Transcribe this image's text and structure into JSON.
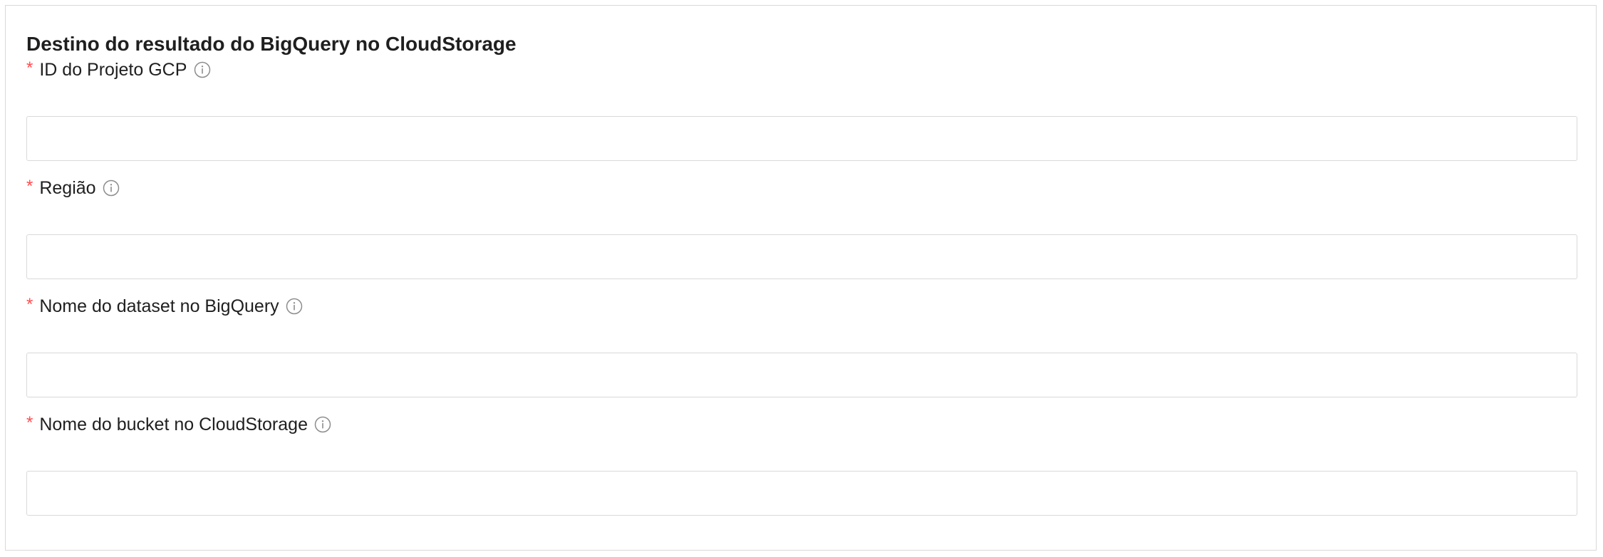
{
  "section": {
    "title": "Destino do resultado do BigQuery no CloudStorage"
  },
  "required_marker": "*",
  "fields": [
    {
      "label": "ID do Projeto GCP",
      "value": "",
      "placeholder": "",
      "info_icon": "info-circle-icon"
    },
    {
      "label": "Região",
      "value": "",
      "placeholder": "",
      "info_icon": "info-circle-icon"
    },
    {
      "label": "Nome do dataset no BigQuery",
      "value": "",
      "placeholder": "",
      "info_icon": "info-circle-icon"
    },
    {
      "label": "Nome do bucket no CloudStorage",
      "value": "",
      "placeholder": "",
      "info_icon": "info-circle-icon"
    }
  ],
  "colors": {
    "required": "#ff4d4f",
    "border": "#d9d9d9",
    "text": "#1f1f1f",
    "icon": "#8c8c8c"
  }
}
